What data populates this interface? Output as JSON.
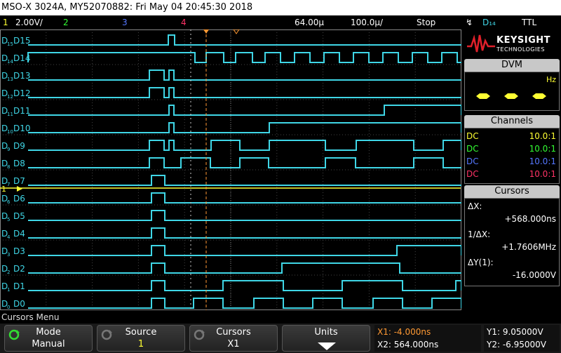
{
  "title": "MSO-X 3024A, MY52070882: Fri May 04 20:45:30 2018",
  "status": {
    "ch1": "1",
    "ch1_scale": "2.00V/",
    "ch2": "2",
    "ch3": "3",
    "ch4": "4",
    "time_ref": "64.00µ",
    "time_scale": "100.0µ/",
    "run_state": "Stop",
    "trig_source": "D₁₄",
    "trig_level": "TTL"
  },
  "colors": {
    "digital": "#3fd6e6",
    "ch1": "#ffff33",
    "ch2": "#33ff33",
    "ch3": "#5577ff",
    "ch4": "#ff3366",
    "cursor": "#ff9933"
  },
  "channels_labels": [
    "D15",
    "D14",
    "D13",
    "D12",
    "D11",
    "D10",
    "D9",
    "D8",
    "D7",
    "D6",
    "D5",
    "D4",
    "D3",
    "D2",
    "D1",
    "D0"
  ],
  "brand": {
    "name": "KEYSIGHT",
    "sub": "TECHNOLOGIES"
  },
  "dvm": {
    "title": "DVM",
    "unit": "Hz"
  },
  "channels_panel": {
    "title": "Channels",
    "rows": [
      {
        "coupling": "DC",
        "probe": "10.0:1"
      },
      {
        "coupling": "DC",
        "probe": "10.0:1"
      },
      {
        "coupling": "DC",
        "probe": "10.0:1"
      },
      {
        "coupling": "DC",
        "probe": "10.0:1"
      }
    ]
  },
  "cursors_panel": {
    "title": "Cursors",
    "dx_label": "ΔX:",
    "dx_value": "+568.000ns",
    "inv_label": "1/ΔX:",
    "inv_value": "+1.7606MHz",
    "dy_label": "ΔY(1):",
    "dy_value": "-16.0000V"
  },
  "menu_title": "Cursors Menu",
  "softkeys": [
    {
      "title": "Mode",
      "value": "Manual"
    },
    {
      "title": "Source",
      "value": "1"
    },
    {
      "title": "Cursors",
      "value": "X1"
    },
    {
      "title": "Units",
      "value": ""
    }
  ],
  "cursor_readout": {
    "x1": "X1: -4.000ns",
    "x2": "X2: 564.000ns",
    "y1": "Y1: 9.05000V",
    "y2": "Y2: -6.95000V"
  }
}
